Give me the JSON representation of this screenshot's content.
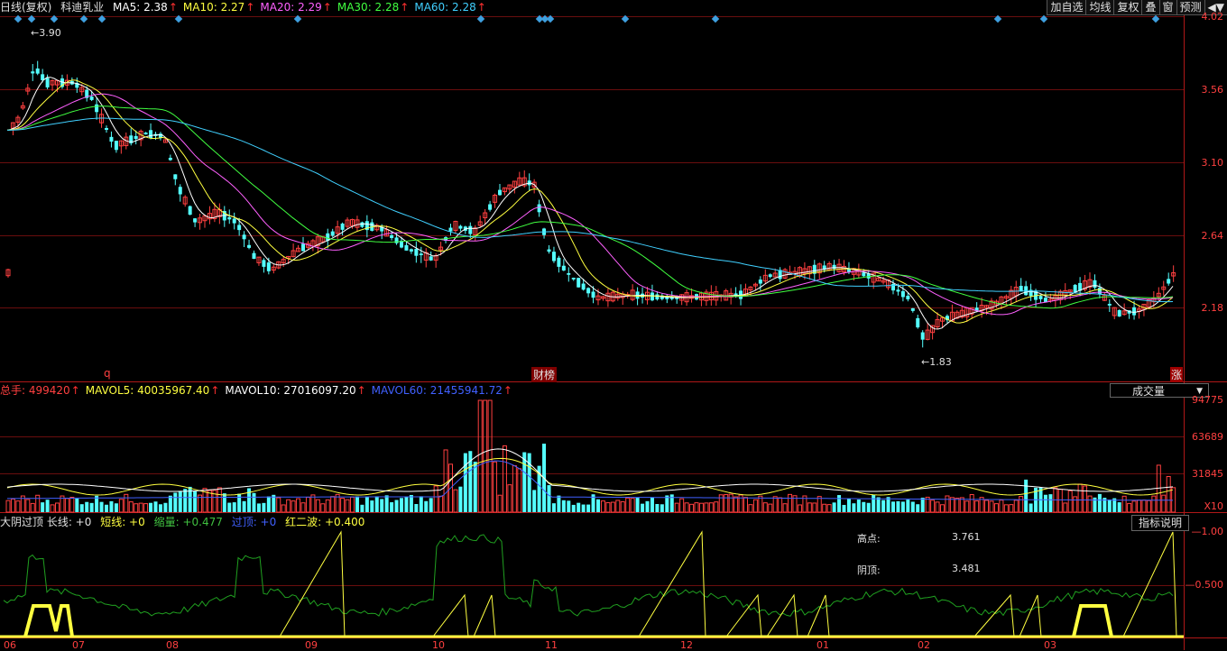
{
  "header": {
    "chart_type": "日线(复权)",
    "stock_name": "科迪乳业",
    "ma": [
      {
        "label": "MA5: 2.38",
        "color": "#ffffff"
      },
      {
        "label": "MA10: 2.27",
        "color": "#ffff40"
      },
      {
        "label": "MA20: 2.29",
        "color": "#ff60ff"
      },
      {
        "label": "MA30: 2.28",
        "color": "#40ff40"
      },
      {
        "label": "MA60: 2.28",
        "color": "#40d0ff"
      }
    ]
  },
  "toolbar": {
    "items": [
      "加自选",
      "均线",
      "复权",
      "叠",
      "窗",
      "预测"
    ],
    "arrows": "◀▼"
  },
  "price_panel": {
    "axis_labels": [
      "4.02",
      "3.56",
      "3.10",
      "2.64",
      "2.18"
    ],
    "high_marker": "3.90",
    "low_marker": "1.83",
    "event_markers": [
      "q",
      "财榜",
      "涨"
    ]
  },
  "volume_panel": {
    "header": [
      {
        "label": "总手: 499420",
        "color": "#ff4040"
      },
      {
        "label": "MAVOL5: 40035967.40",
        "color": "#ffff40"
      },
      {
        "label": "MAVOL10: 27016097.20",
        "color": "#ffffff"
      },
      {
        "label": "MAVOL60: 21455941.72",
        "color": "#4060ff"
      }
    ],
    "dropdown": "成交量",
    "axis_labels": [
      "94775",
      "63689",
      "31845"
    ],
    "axis_unit": "X10"
  },
  "indicator_panel": {
    "header": [
      {
        "label": "大阴过顶 长线: +0",
        "color": "#e0e0e0"
      },
      {
        "label": "短线: +0",
        "color": "#ffff40"
      },
      {
        "label": "缩量: +0.477",
        "color": "#40c040"
      },
      {
        "label": "过顶: +0",
        "color": "#4060ff"
      },
      {
        "label": "红二波: +0.400",
        "color": "#ffff40"
      }
    ],
    "button": "指标说明",
    "axis_labels": [
      "1.00",
      "0.500"
    ],
    "info": [
      {
        "label": "高点:",
        "value": "3.761"
      },
      {
        "label": "阴顶:",
        "value": "3.481"
      }
    ]
  },
  "x_axis": [
    "06",
    "07",
    "08",
    "09",
    "10",
    "11",
    "12",
    "01",
    "02",
    "03"
  ]
}
